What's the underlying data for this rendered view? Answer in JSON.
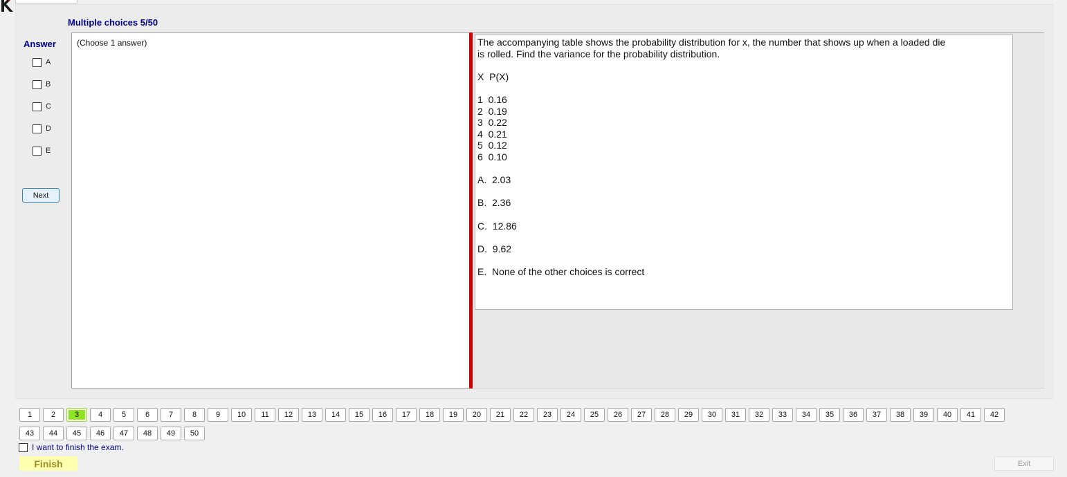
{
  "header": {
    "title": "Multiple choices 5/50"
  },
  "answer": {
    "label": "Answer",
    "options": [
      "A",
      "B",
      "C",
      "D",
      "E"
    ],
    "next_label": "Next"
  },
  "left": {
    "instruction": "(Choose 1 answer)"
  },
  "question": {
    "text": "The accompanying table shows the probability distribution for x, the number that shows up when a loaded die\nis rolled. Find the variance for the probability distribution.\n\nX  P(X)\n\n1  0.16\n2  0.19\n3  0.22\n4  0.21\n5  0.12\n6  0.10\n\nA.  2.03\n\nB.  2.36\n\nC.  12.86\n\nD.  9.62\n\nE.  None of the other choices is correct"
  },
  "navigation": {
    "questions": [
      "1",
      "2",
      "3",
      "4",
      "5",
      "6",
      "7",
      "8",
      "9",
      "10",
      "11",
      "12",
      "13",
      "14",
      "15",
      "16",
      "17",
      "18",
      "19",
      "20",
      "21",
      "22",
      "23",
      "24",
      "25",
      "26",
      "27",
      "28",
      "29",
      "30",
      "31",
      "32",
      "33",
      "34",
      "35",
      "36",
      "37",
      "38",
      "39",
      "40",
      "41",
      "42",
      "43",
      "44",
      "45",
      "46",
      "47",
      "48",
      "49",
      "50"
    ],
    "highlighted": "3"
  },
  "footer": {
    "finish_check_label": "I want to finish the exam.",
    "finish_label": "Finish",
    "exit_label": "Exit"
  },
  "colors": {
    "title": "#00008b",
    "splitter": "#d10000",
    "highlight": "#8fe322",
    "finish_bg": "#ffffb0"
  },
  "icons": {
    "logo": "k-logo-icon"
  }
}
